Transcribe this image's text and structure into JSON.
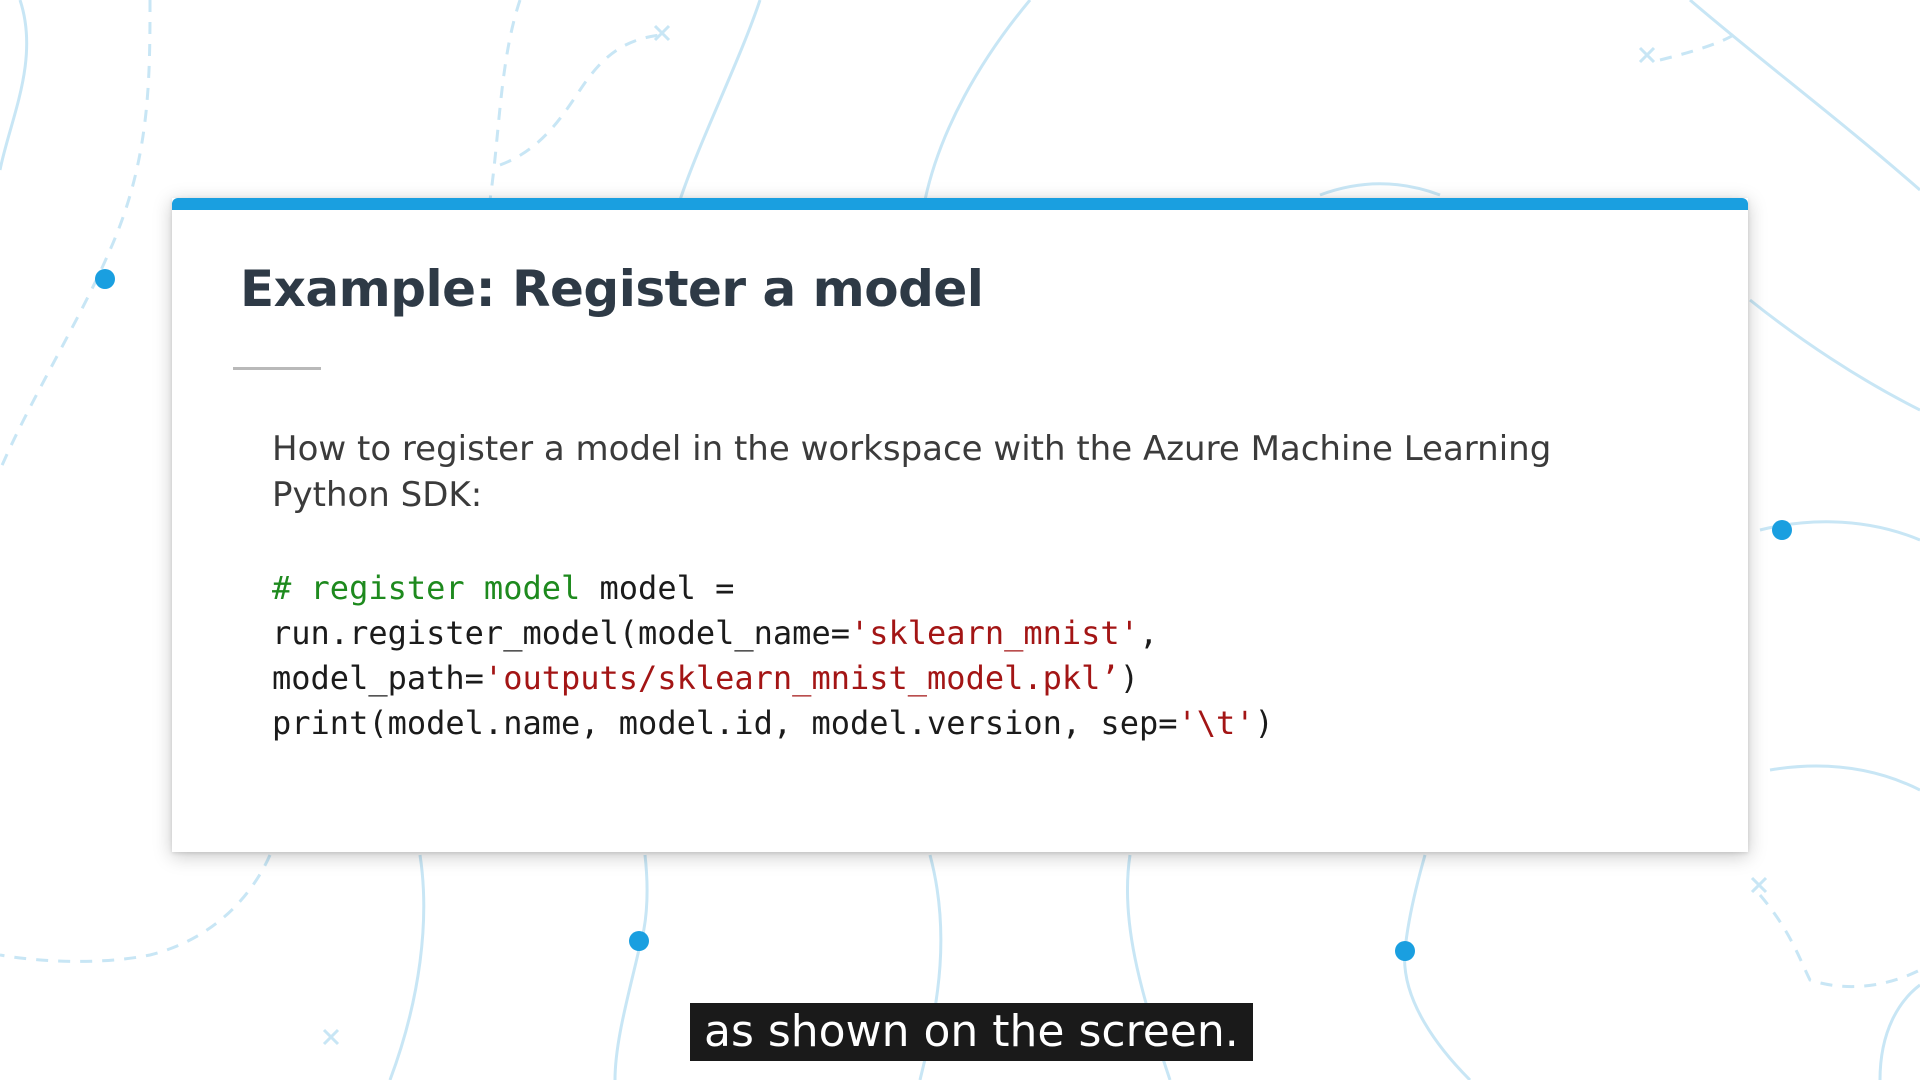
{
  "slide": {
    "title": "Example: Register a model",
    "description": "How to register a model in the workspace with the Azure Machine Learning Python SDK:",
    "code": {
      "line1_comment": "# register model",
      "line1_rest": " model =",
      "line2_prefix": "run.register_model(model_name=",
      "line2_string": "'sklearn_mnist'",
      "line2_suffix": ",",
      "line3_prefix": "model_path=",
      "line3_string": "'outputs/sklearn_mnist_model.pkl’",
      "line3_suffix": ")",
      "line4_prefix": "print(model.name, model.id, model.version, sep=",
      "line4_string": "'\\t'",
      "line4_suffix": ")"
    }
  },
  "caption": {
    "text": "as shown on the screen."
  },
  "colors": {
    "accent": "#1a9fe0",
    "background_lines": "#c8e6f5",
    "dot": "#1a9fe0",
    "title": "#2e3a46",
    "code_comment": "#1e8a1e",
    "code_string": "#a31515"
  }
}
